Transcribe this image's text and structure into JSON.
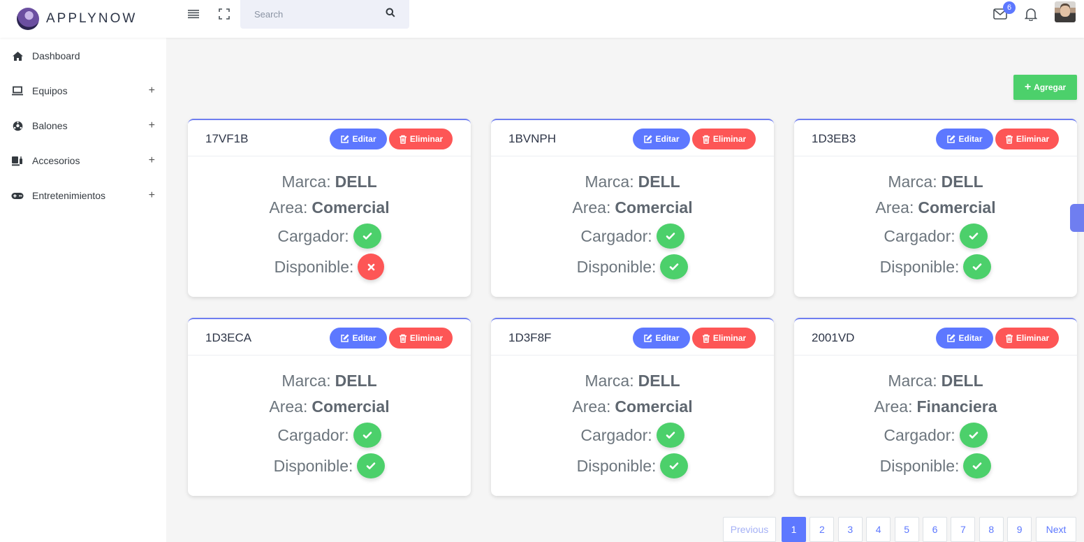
{
  "brand": {
    "name": "APPLYNOW"
  },
  "search": {
    "placeholder": "Search"
  },
  "header": {
    "mail_count": "6"
  },
  "sidebar": {
    "items": [
      {
        "label": "Dashboard",
        "icon": "home-icon",
        "expandable": false
      },
      {
        "label": "Equipos",
        "icon": "laptop-icon",
        "expandable": true
      },
      {
        "label": "Balones",
        "icon": "soccer-ball-icon",
        "expandable": true
      },
      {
        "label": "Accesorios",
        "icon": "accessories-icon",
        "expandable": true
      },
      {
        "label": "Entretenimientos",
        "icon": "gamepad-icon",
        "expandable": true
      }
    ],
    "plus": "+"
  },
  "toolbar": {
    "add_label": "Agregar"
  },
  "card_labels": {
    "edit": "Editar",
    "delete": "Eliminar",
    "marca": "Marca:",
    "area": "Area:",
    "cargador": "Cargador:",
    "disponible": "Disponible:"
  },
  "cards": [
    {
      "code": "17VF1B",
      "marca": "DELL",
      "area": "Comercial",
      "cargador": true,
      "disponible": false
    },
    {
      "code": "1BVNPH",
      "marca": "DELL",
      "area": "Comercial",
      "cargador": true,
      "disponible": true
    },
    {
      "code": "1D3EB3",
      "marca": "DELL",
      "area": "Comercial",
      "cargador": true,
      "disponible": true
    },
    {
      "code": "1D3ECA",
      "marca": "DELL",
      "area": "Comercial",
      "cargador": true,
      "disponible": true
    },
    {
      "code": "1D3F8F",
      "marca": "DELL",
      "area": "Comercial",
      "cargador": true,
      "disponible": true
    },
    {
      "code": "2001VD",
      "marca": "DELL",
      "area": "Financiera",
      "cargador": true,
      "disponible": true
    }
  ],
  "pagination": {
    "previous": "Previous",
    "next": "Next",
    "pages": [
      "1",
      "2",
      "3",
      "4",
      "5",
      "6",
      "7",
      "8",
      "9"
    ],
    "current": "1"
  },
  "colors": {
    "primary": "#5d78ff",
    "success": "#4cd06b",
    "danger": "#fd5656"
  }
}
